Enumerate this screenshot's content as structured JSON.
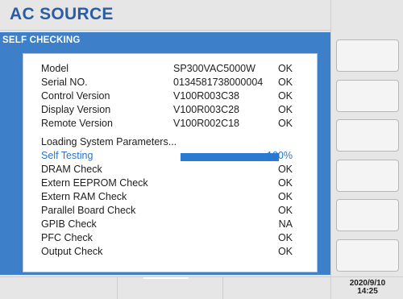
{
  "app": {
    "title": "AC SOURCE"
  },
  "panel": {
    "title": "SELF CHECKING",
    "rows": [
      {
        "name": "Model",
        "value": "SP300VAC5000W",
        "status": "OK"
      },
      {
        "name": "Serial NO.",
        "value": "0134581738000004",
        "status": "OK"
      },
      {
        "name": "Control Version",
        "value": "V100R003C38",
        "status": "OK"
      },
      {
        "name": "Display Version",
        "value": "V100R003C28",
        "status": "OK"
      },
      {
        "name": "Remote Version",
        "value": "V100R002C18",
        "status": "OK"
      }
    ],
    "loading_text": "Loading System Parameters...",
    "self_testing": {
      "label": "Self Testing",
      "progress_percent": 100,
      "progress_text": "100%"
    },
    "checks": [
      {
        "name": "DRAM Check",
        "status": "OK"
      },
      {
        "name": "Extern EEPROM Check",
        "status": "OK"
      },
      {
        "name": "Extern RAM Check",
        "status": "OK"
      },
      {
        "name": "Parallel Board Check",
        "status": "OK"
      },
      {
        "name": "GPIB Check",
        "status": "NA"
      },
      {
        "name": "PFC Check",
        "status": "OK"
      },
      {
        "name": "Output Check",
        "status": "OK"
      }
    ]
  },
  "clock": {
    "date": "2020/9/10",
    "time": "14:25"
  },
  "colors": {
    "accent": "#3d7fc8",
    "title": "#2a5da3",
    "active_text": "#2c73c9",
    "progress": "#2b7ad1"
  }
}
